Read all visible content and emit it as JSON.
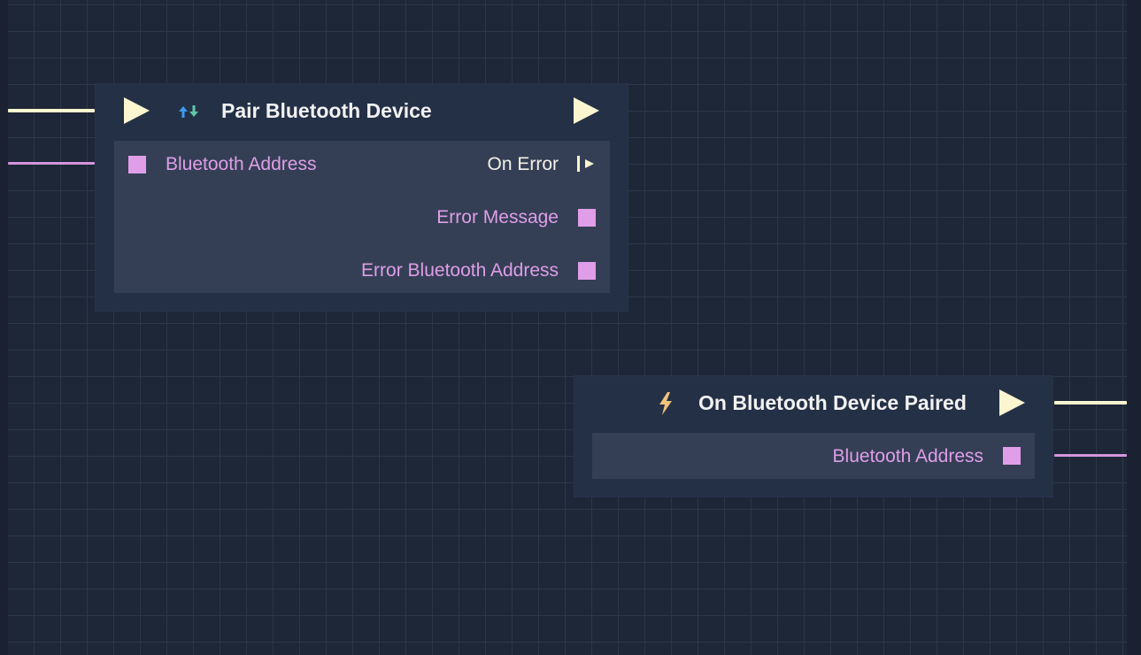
{
  "colors": {
    "canvas_background": "#1e2737",
    "grid_line": "#2b3747",
    "node_background": "#243046",
    "node_body": "#343f55",
    "exec_pin": "#fbf6cf",
    "data_pin": "#e09ee8",
    "data_label": "#df9ee7",
    "exec_label": "#f4f2e8",
    "title_text": "#f2f2f2",
    "event_icon": "#f0c27a",
    "action_icon_up": "#3b9cf0",
    "action_icon_down": "#5fc7a8"
  },
  "nodes": {
    "pair": {
      "title": "Pair Bluetooth Device",
      "icon": "arrows-up-down-icon",
      "inputs": {
        "bluetooth_address": "Bluetooth Address"
      },
      "outputs": {
        "on_error": "On Error",
        "error_message": "Error Message",
        "error_bluetooth_address": "Error Bluetooth Address"
      }
    },
    "paired_event": {
      "title": "On Bluetooth Device Paired",
      "icon": "lightning-bolt-icon",
      "outputs": {
        "bluetooth_address": "Bluetooth Address"
      }
    }
  }
}
